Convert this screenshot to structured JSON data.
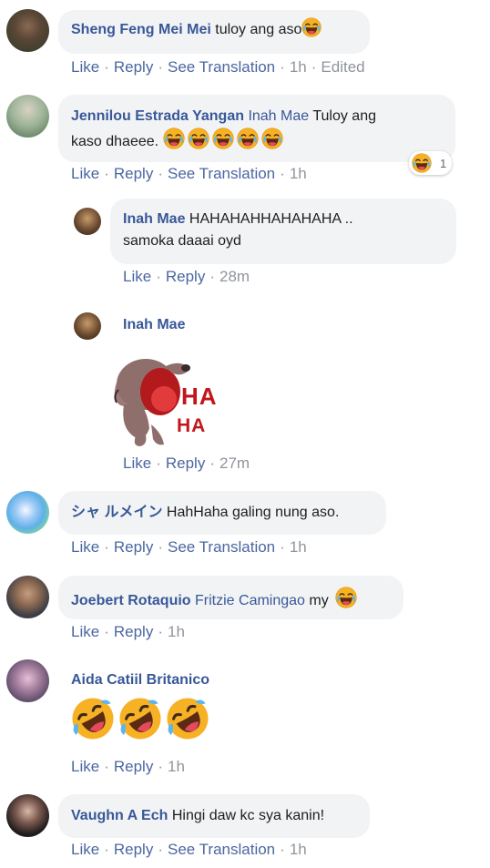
{
  "comments": [
    {
      "name": "Sheng Feng Mei Mei",
      "text": "tuloy ang aso",
      "actions": {
        "like": "Like",
        "reply": "Reply",
        "translate": "See Translation",
        "time": "1h",
        "edited": "Edited"
      }
    },
    {
      "name": "Jennilou Estrada Yangan",
      "tag": "Inah Mae",
      "text1": "Tuloy ang",
      "text2": "kaso dhaeee.",
      "reaction_count": "1",
      "actions": {
        "like": "Like",
        "reply": "Reply",
        "translate": "See Translation",
        "time": "1h"
      }
    },
    {
      "name": "Inah Mae",
      "text1": "HAHAHAHHAHAHAHA ..",
      "text2": "samoka daaai oyd",
      "actions": {
        "like": "Like",
        "reply": "Reply",
        "time": "28m"
      }
    },
    {
      "name": "Inah Mae",
      "sticker_text1": "HA",
      "sticker_text2": "HA",
      "actions": {
        "like": "Like",
        "reply": "Reply",
        "time": "27m"
      }
    },
    {
      "name": "シャ ルメイン",
      "text": "HahHaha galing nung aso.",
      "actions": {
        "like": "Like",
        "reply": "Reply",
        "translate": "See Translation",
        "time": "1h"
      }
    },
    {
      "name": "Joebert Rotaquio",
      "tag": "Fritzie Camingao",
      "text": "my",
      "actions": {
        "like": "Like",
        "reply": "Reply",
        "time": "1h"
      }
    },
    {
      "name": "Aida Catiil Britanico",
      "actions": {
        "like": "Like",
        "reply": "Reply",
        "time": "1h"
      }
    },
    {
      "name": "Vaughn A Ech",
      "text": "Hingi daw kc sya kanin!",
      "actions": {
        "like": "Like",
        "reply": "Reply",
        "translate": "See Translation",
        "time": "1h"
      }
    }
  ],
  "colors": {
    "link": "#385898",
    "action": "#4b67a1",
    "bubble": "#f2f3f5",
    "meta": "#90949c"
  }
}
